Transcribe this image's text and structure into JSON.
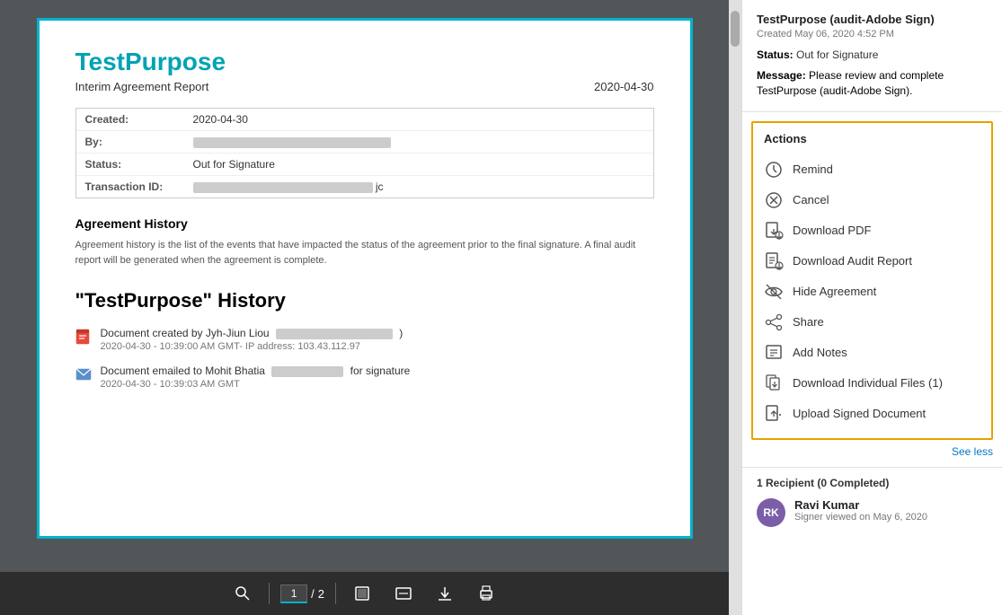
{
  "document": {
    "title": "TestPurpose",
    "subtitle": "Interim Agreement Report",
    "date": "2020-04-30",
    "info": {
      "created_label": "Created:",
      "created_value": "2020-04-30",
      "by_label": "By:",
      "status_label": "Status:",
      "status_value": "Out for Signature",
      "transaction_label": "Transaction ID:"
    },
    "history_section_title": "Agreement History",
    "history_desc": "Agreement history is the list of the events that have impacted the status of the agreement prior to the final signature. A final audit report will be generated when the agreement is complete.",
    "history_title": "\"TestPurpose\" History",
    "history_items": [
      {
        "text": "Document created by Jyh-Jiun Liou",
        "date": "2020-04-30 - 10:39:00 AM GMT- IP address: 103.43.112.97"
      },
      {
        "text": "Document emailed to Mohit Bhatia for signature",
        "date": "2020-04-30 - 10:39:03 AM GMT"
      }
    ]
  },
  "toolbar": {
    "page_current": "1",
    "page_separator": "/",
    "page_total": "2"
  },
  "right_panel": {
    "agreement_title": "TestPurpose (audit-Adobe Sign)",
    "created": "Created May 06, 2020 4:52 PM",
    "status_label": "Status:",
    "status_value": "Out for Signature",
    "message_label": "Message:",
    "message_value": "Please review and complete TestPurpose (audit-Adobe Sign).",
    "actions_title": "Actions",
    "actions": [
      {
        "label": "Remind",
        "icon": "clock"
      },
      {
        "label": "Cancel",
        "icon": "cancel"
      },
      {
        "label": "Download PDF",
        "icon": "download-pdf"
      },
      {
        "label": "Download Audit Report",
        "icon": "download-audit"
      },
      {
        "label": "Hide Agreement",
        "icon": "hide"
      },
      {
        "label": "Share",
        "icon": "share"
      },
      {
        "label": "Add Notes",
        "icon": "notes"
      },
      {
        "label": "Download Individual Files (1)",
        "icon": "download-files"
      },
      {
        "label": "Upload Signed Document",
        "icon": "upload"
      }
    ],
    "see_less": "See less",
    "recipients_title": "1 Recipient (0 Completed)",
    "recipient": {
      "name": "Ravi Kumar",
      "initials": "RK",
      "status": "Signer viewed on May 6, 2020"
    }
  }
}
